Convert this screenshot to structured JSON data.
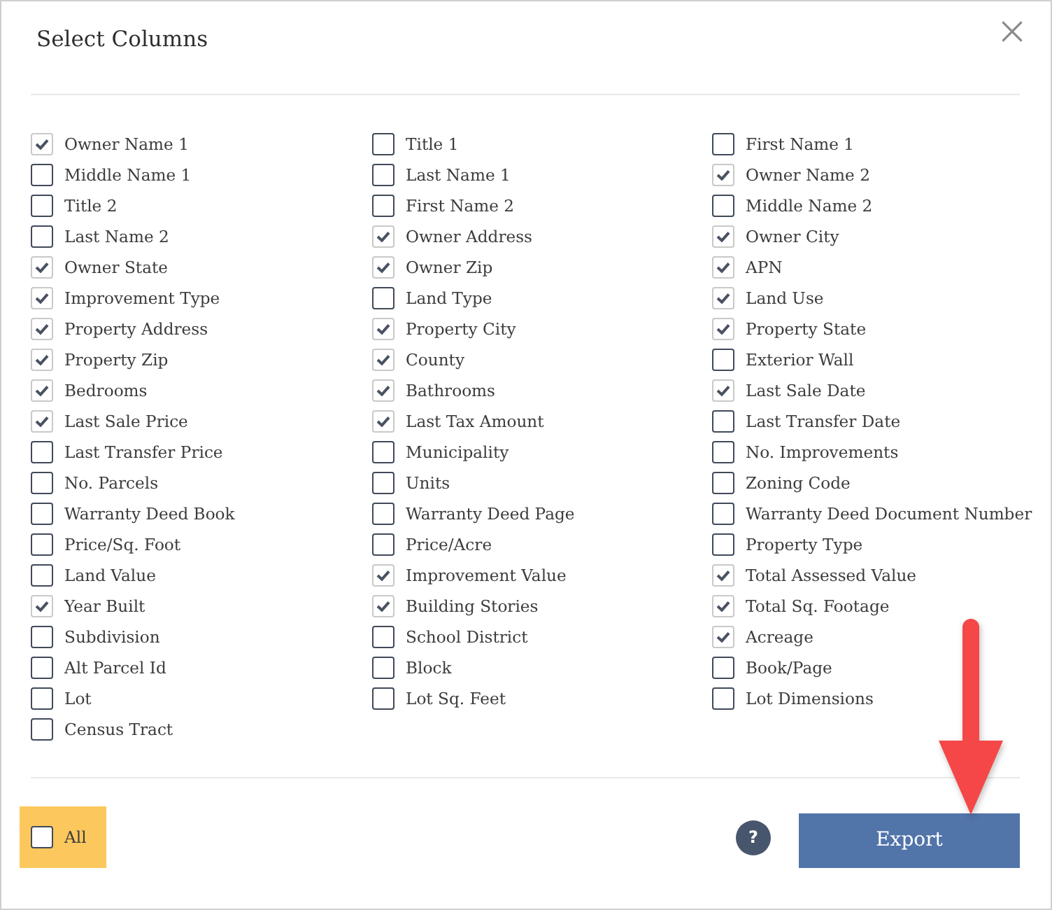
{
  "title": "Select Columns",
  "columns": [
    {
      "label": "Owner Name 1",
      "checked": true
    },
    {
      "label": "Title 1",
      "checked": false
    },
    {
      "label": "First Name 1",
      "checked": false
    },
    {
      "label": "Middle Name 1",
      "checked": false
    },
    {
      "label": "Last Name 1",
      "checked": false
    },
    {
      "label": "Owner Name 2",
      "checked": true
    },
    {
      "label": "Title 2",
      "checked": false
    },
    {
      "label": "First Name 2",
      "checked": false
    },
    {
      "label": "Middle Name 2",
      "checked": false
    },
    {
      "label": "Last Name 2",
      "checked": false
    },
    {
      "label": "Owner Address",
      "checked": true
    },
    {
      "label": "Owner City",
      "checked": true
    },
    {
      "label": "Owner State",
      "checked": true
    },
    {
      "label": "Owner Zip",
      "checked": true
    },
    {
      "label": "APN",
      "checked": true
    },
    {
      "label": "Improvement Type",
      "checked": true
    },
    {
      "label": "Land Type",
      "checked": false
    },
    {
      "label": "Land Use",
      "checked": true
    },
    {
      "label": "Property Address",
      "checked": true
    },
    {
      "label": "Property City",
      "checked": true
    },
    {
      "label": "Property State",
      "checked": true
    },
    {
      "label": "Property Zip",
      "checked": true
    },
    {
      "label": "County",
      "checked": true
    },
    {
      "label": "Exterior Wall",
      "checked": false
    },
    {
      "label": "Bedrooms",
      "checked": true
    },
    {
      "label": "Bathrooms",
      "checked": true
    },
    {
      "label": "Last Sale Date",
      "checked": true
    },
    {
      "label": "Last Sale Price",
      "checked": true
    },
    {
      "label": "Last Tax Amount",
      "checked": true
    },
    {
      "label": "Last Transfer Date",
      "checked": false
    },
    {
      "label": "Last Transfer Price",
      "checked": false
    },
    {
      "label": "Municipality",
      "checked": false
    },
    {
      "label": "No. Improvements",
      "checked": false
    },
    {
      "label": "No. Parcels",
      "checked": false
    },
    {
      "label": "Units",
      "checked": false
    },
    {
      "label": "Zoning Code",
      "checked": false
    },
    {
      "label": "Warranty Deed Book",
      "checked": false
    },
    {
      "label": "Warranty Deed Page",
      "checked": false
    },
    {
      "label": "Warranty Deed Document Number",
      "checked": false
    },
    {
      "label": "Price/Sq. Foot",
      "checked": false
    },
    {
      "label": "Price/Acre",
      "checked": false
    },
    {
      "label": "Property Type",
      "checked": false
    },
    {
      "label": "Land Value",
      "checked": false
    },
    {
      "label": "Improvement Value",
      "checked": true
    },
    {
      "label": "Total Assessed Value",
      "checked": true
    },
    {
      "label": "Year Built",
      "checked": true
    },
    {
      "label": "Building Stories",
      "checked": true
    },
    {
      "label": "Total Sq. Footage",
      "checked": true
    },
    {
      "label": "Subdivision",
      "checked": false
    },
    {
      "label": "School District",
      "checked": false
    },
    {
      "label": "Acreage",
      "checked": true
    },
    {
      "label": "Alt Parcel Id",
      "checked": false
    },
    {
      "label": "Block",
      "checked": false
    },
    {
      "label": "Book/Page",
      "checked": false
    },
    {
      "label": "Lot",
      "checked": false
    },
    {
      "label": "Lot Sq. Feet",
      "checked": false
    },
    {
      "label": "Lot Dimensions",
      "checked": false
    },
    {
      "label": "Census Tract",
      "checked": false
    }
  ],
  "select_all": {
    "label": "All",
    "checked": false,
    "highlighted": true
  },
  "help_button": "?",
  "export_button": "Export"
}
